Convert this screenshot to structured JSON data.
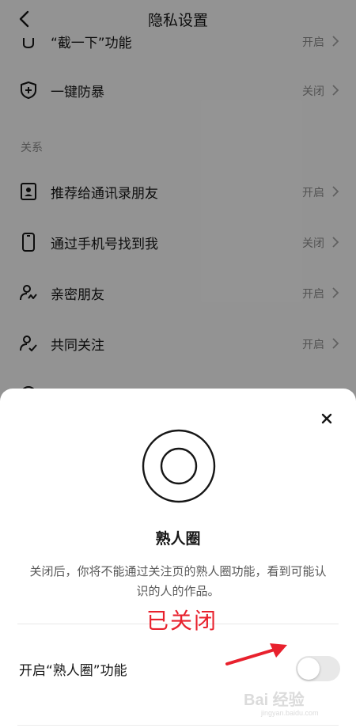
{
  "header": {
    "title": "隐私设置"
  },
  "rows_top": [
    {
      "label": "“截一下”功能",
      "value": "开启",
      "icon": "hand-icon"
    },
    {
      "label": "一键防暴",
      "value": "关闭",
      "icon": "shield-plus-icon"
    }
  ],
  "section": {
    "label": "关系"
  },
  "rows_relation": [
    {
      "label": "推荐给通讯录朋友",
      "value": "开启",
      "icon": "contact-card-icon"
    },
    {
      "label": "通过手机号找到我",
      "value": "关闭",
      "icon": "phone-icon"
    },
    {
      "label": "亲密朋友",
      "value": "开启",
      "icon": "user-heart-icon"
    },
    {
      "label": "共同关注",
      "value": "开启",
      "icon": "user-check-icon"
    }
  ],
  "sheet": {
    "icon": "circle-ring-icon",
    "title": "熟人圈",
    "description": "关闭后，你将不能通过关注页的熟人圈功能，看到可能认识的人的作品。",
    "toggle_label": "开启“熟人圈”功能",
    "toggle_state": "off",
    "annotation": "已关闭"
  },
  "colors": {
    "annotation": "#e8212d",
    "toggle_off": "#e8e8e8"
  },
  "watermark": {
    "main": "Bai 经验",
    "sub": "jingyan.baidu.com"
  }
}
